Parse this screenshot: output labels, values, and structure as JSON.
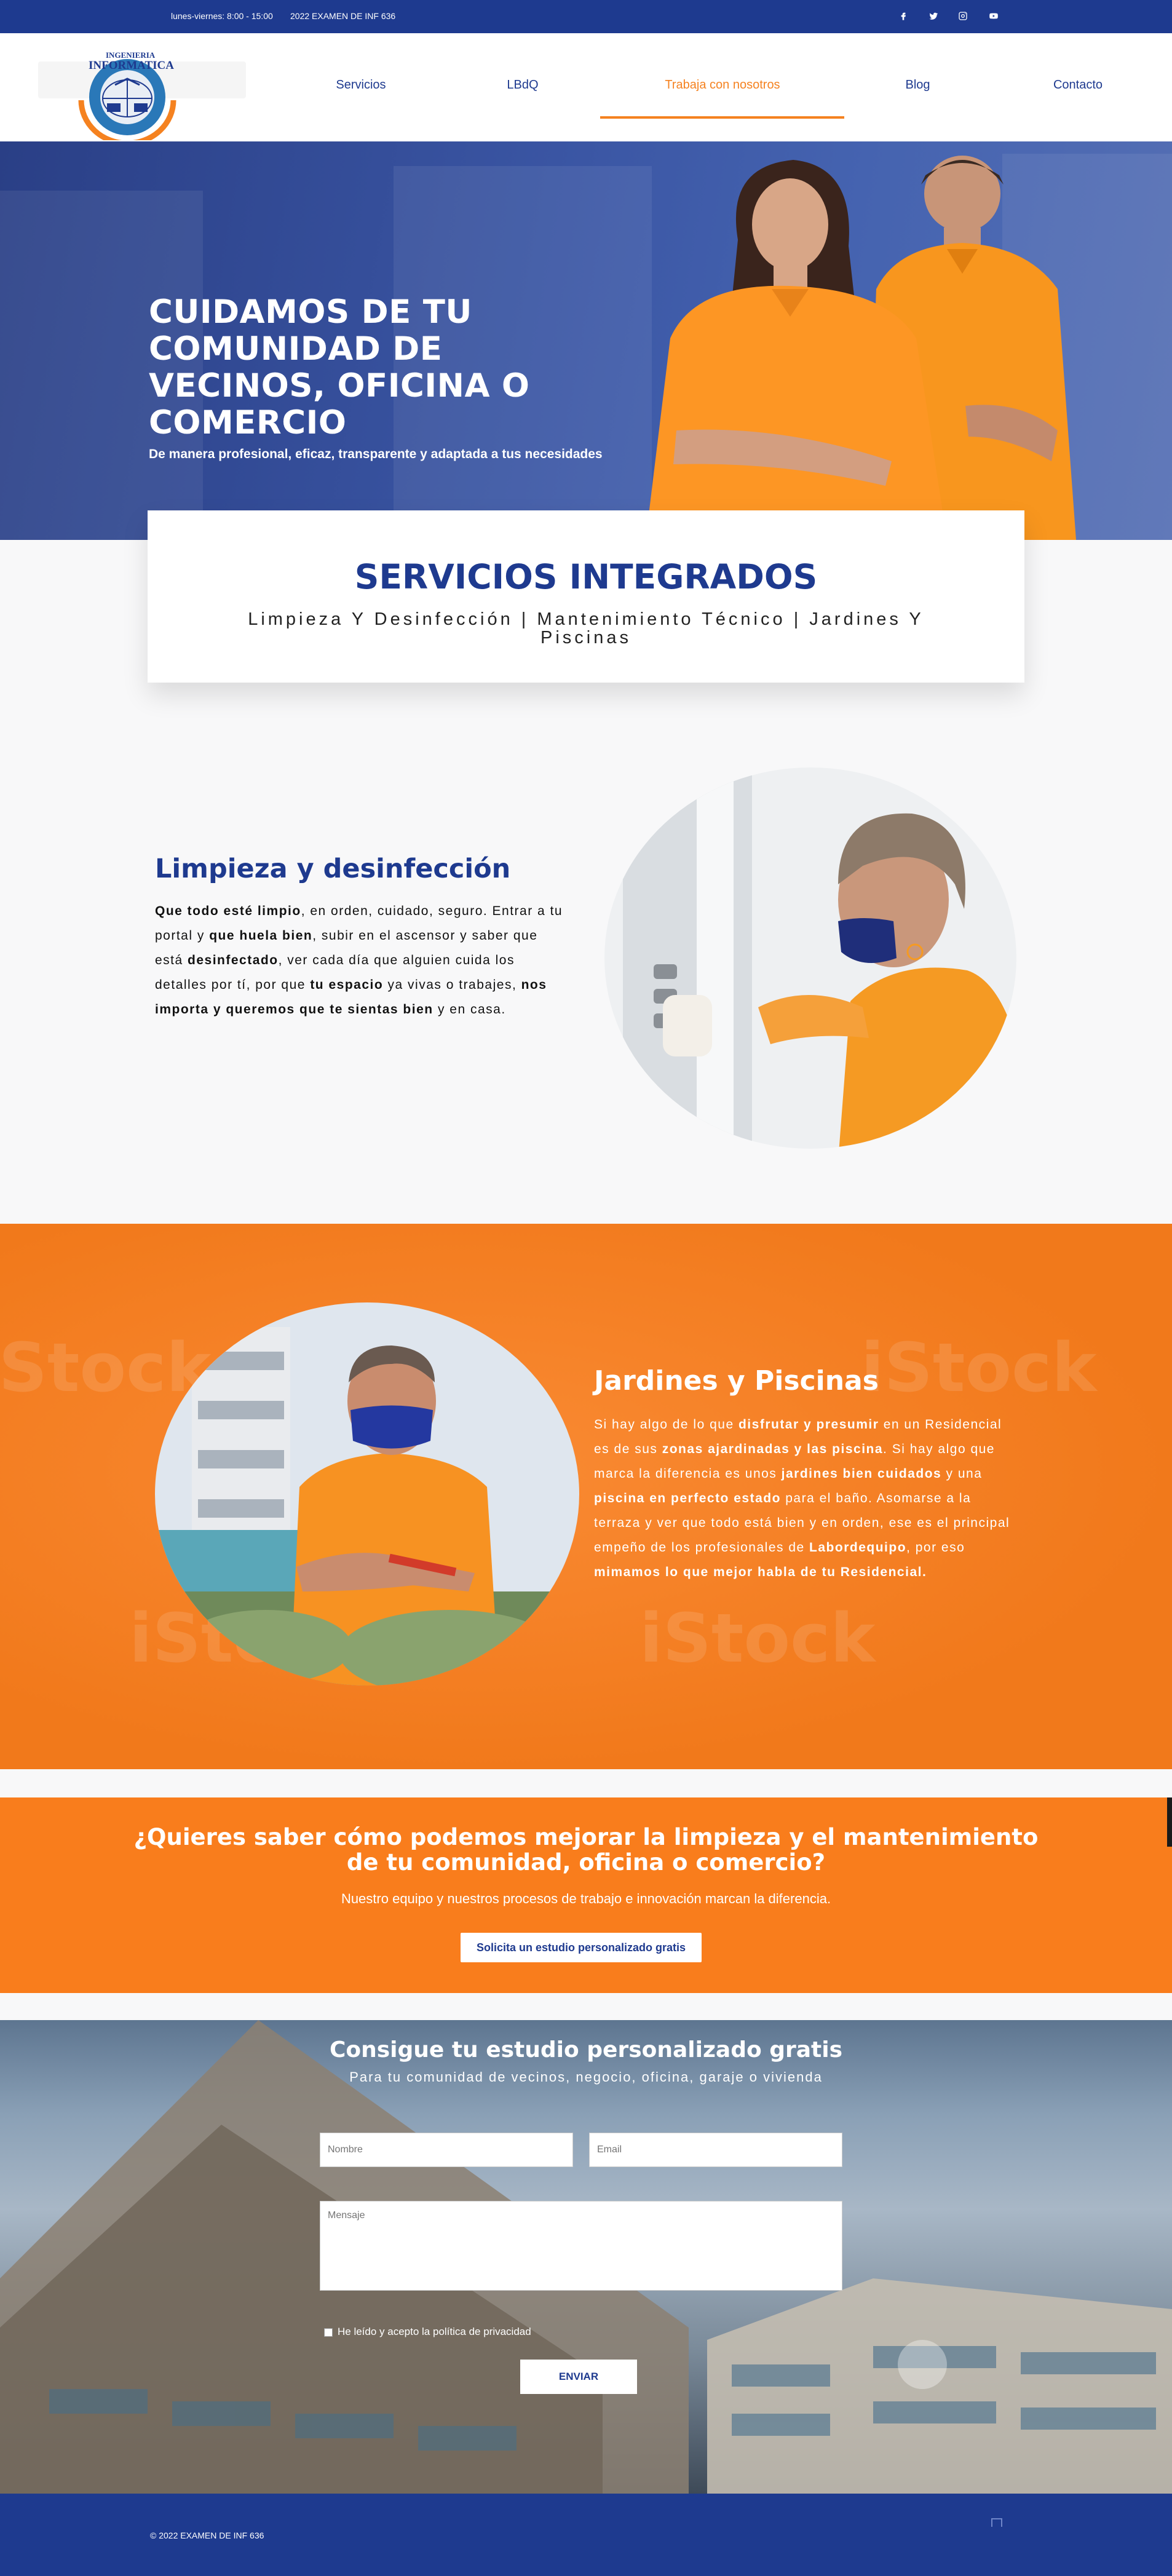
{
  "colors": {
    "brand_blue": "#1e3a8f",
    "accent_orange": "#f58220",
    "section_orange": "#f97d1c"
  },
  "topbar": {
    "hours": "lunes-viernes: 8:00 - 15:00",
    "exam": "2022 EXAMEN DE INF 636",
    "social": [
      "facebook-icon",
      "twitter-icon",
      "instagram-icon",
      "youtube-icon"
    ]
  },
  "header": {
    "logo_line1": "INGENIERIA",
    "logo_line2": "INFORMATICA",
    "nav": [
      "Servicios",
      "LBdQ",
      "Trabaja con nosotros",
      "Blog",
      "Contacto"
    ],
    "active_nav": "Trabaja con nosotros"
  },
  "hero": {
    "title": "CUIDAMOS DE TU COMUNIDAD DE VECINOS, OFICINA O COMERCIO",
    "subtitle": "De manera profesional, eficaz, transparente y adaptada a tus necesidades"
  },
  "services": {
    "title": "SERVICIOS INTEGRADOS",
    "list": "Limpieza Y Desinfección | Mantenimiento Técnico  | Jardines Y Piscinas"
  },
  "limpieza": {
    "title": "Limpieza y desinfección",
    "parts": [
      {
        "t": "Que todo esté limpio",
        "b": true
      },
      {
        "t": ", en orden, cuidado, seguro. Entrar a tu portal y ",
        "b": false
      },
      {
        "t": "que huela bien",
        "b": true
      },
      {
        "t": ", subir en el ascensor y saber que está ",
        "b": false
      },
      {
        "t": "desinfectado",
        "b": true
      },
      {
        "t": ", ver cada día que alguien cuida los detalles por tí, por que ",
        "b": false
      },
      {
        "t": "tu espacio",
        "b": true
      },
      {
        "t": " ya vivas o trabajes, ",
        "b": false
      },
      {
        "t": "nos importa y queremos que te sientas bien",
        "b": true
      },
      {
        "t": " y en casa.",
        "b": false
      }
    ]
  },
  "jardines": {
    "title": "Jardines y Piscinas",
    "watermark": "iStock",
    "parts": [
      {
        "t": "Si hay algo de lo que ",
        "b": false
      },
      {
        "t": "disfrutar y presumir",
        "b": true
      },
      {
        "t": " en un Residencial es de sus ",
        "b": false
      },
      {
        "t": "zonas ajardinadas y las piscina",
        "b": true
      },
      {
        "t": ". Si hay algo que marca la diferencia es unos ",
        "b": false
      },
      {
        "t": "jardines bien cuidados",
        "b": true
      },
      {
        "t": " y una ",
        "b": false
      },
      {
        "t": "piscina en perfecto estado",
        "b": true
      },
      {
        "t": " para el baño. Asomarse a la terraza y ver que todo está bien y en orden, ese es el principal empeño de los profesionales de ",
        "b": false
      },
      {
        "t": "Labordequipo",
        "b": true
      },
      {
        "t": ", por eso ",
        "b": false
      },
      {
        "t": "mimamos lo que mejor habla de tu Residencial.",
        "b": true
      }
    ]
  },
  "cta": {
    "title": "¿Quieres saber cómo podemos mejorar la limpieza y el mantenimiento de tu comunidad, oficina o comercio?",
    "subtitle": "Nuestro equipo y nuestros procesos de trabajo e innovación marcan la diferencia.",
    "button": "Solicita un estudio personalizado gratis"
  },
  "form": {
    "title": "Consigue tu estudio personalizado gratis",
    "subtitle": "Para tu comunidad de vecinos, negocio, oficina, garaje o vivienda",
    "name_placeholder": "Nombre",
    "email_placeholder": "Email",
    "message_placeholder": "Mensaje",
    "privacy": "He leído y acepto la política de privacidad",
    "submit": "ENVIAR"
  },
  "footer": {
    "copyright": "© 2022 EXAMEN DE INF 636"
  }
}
